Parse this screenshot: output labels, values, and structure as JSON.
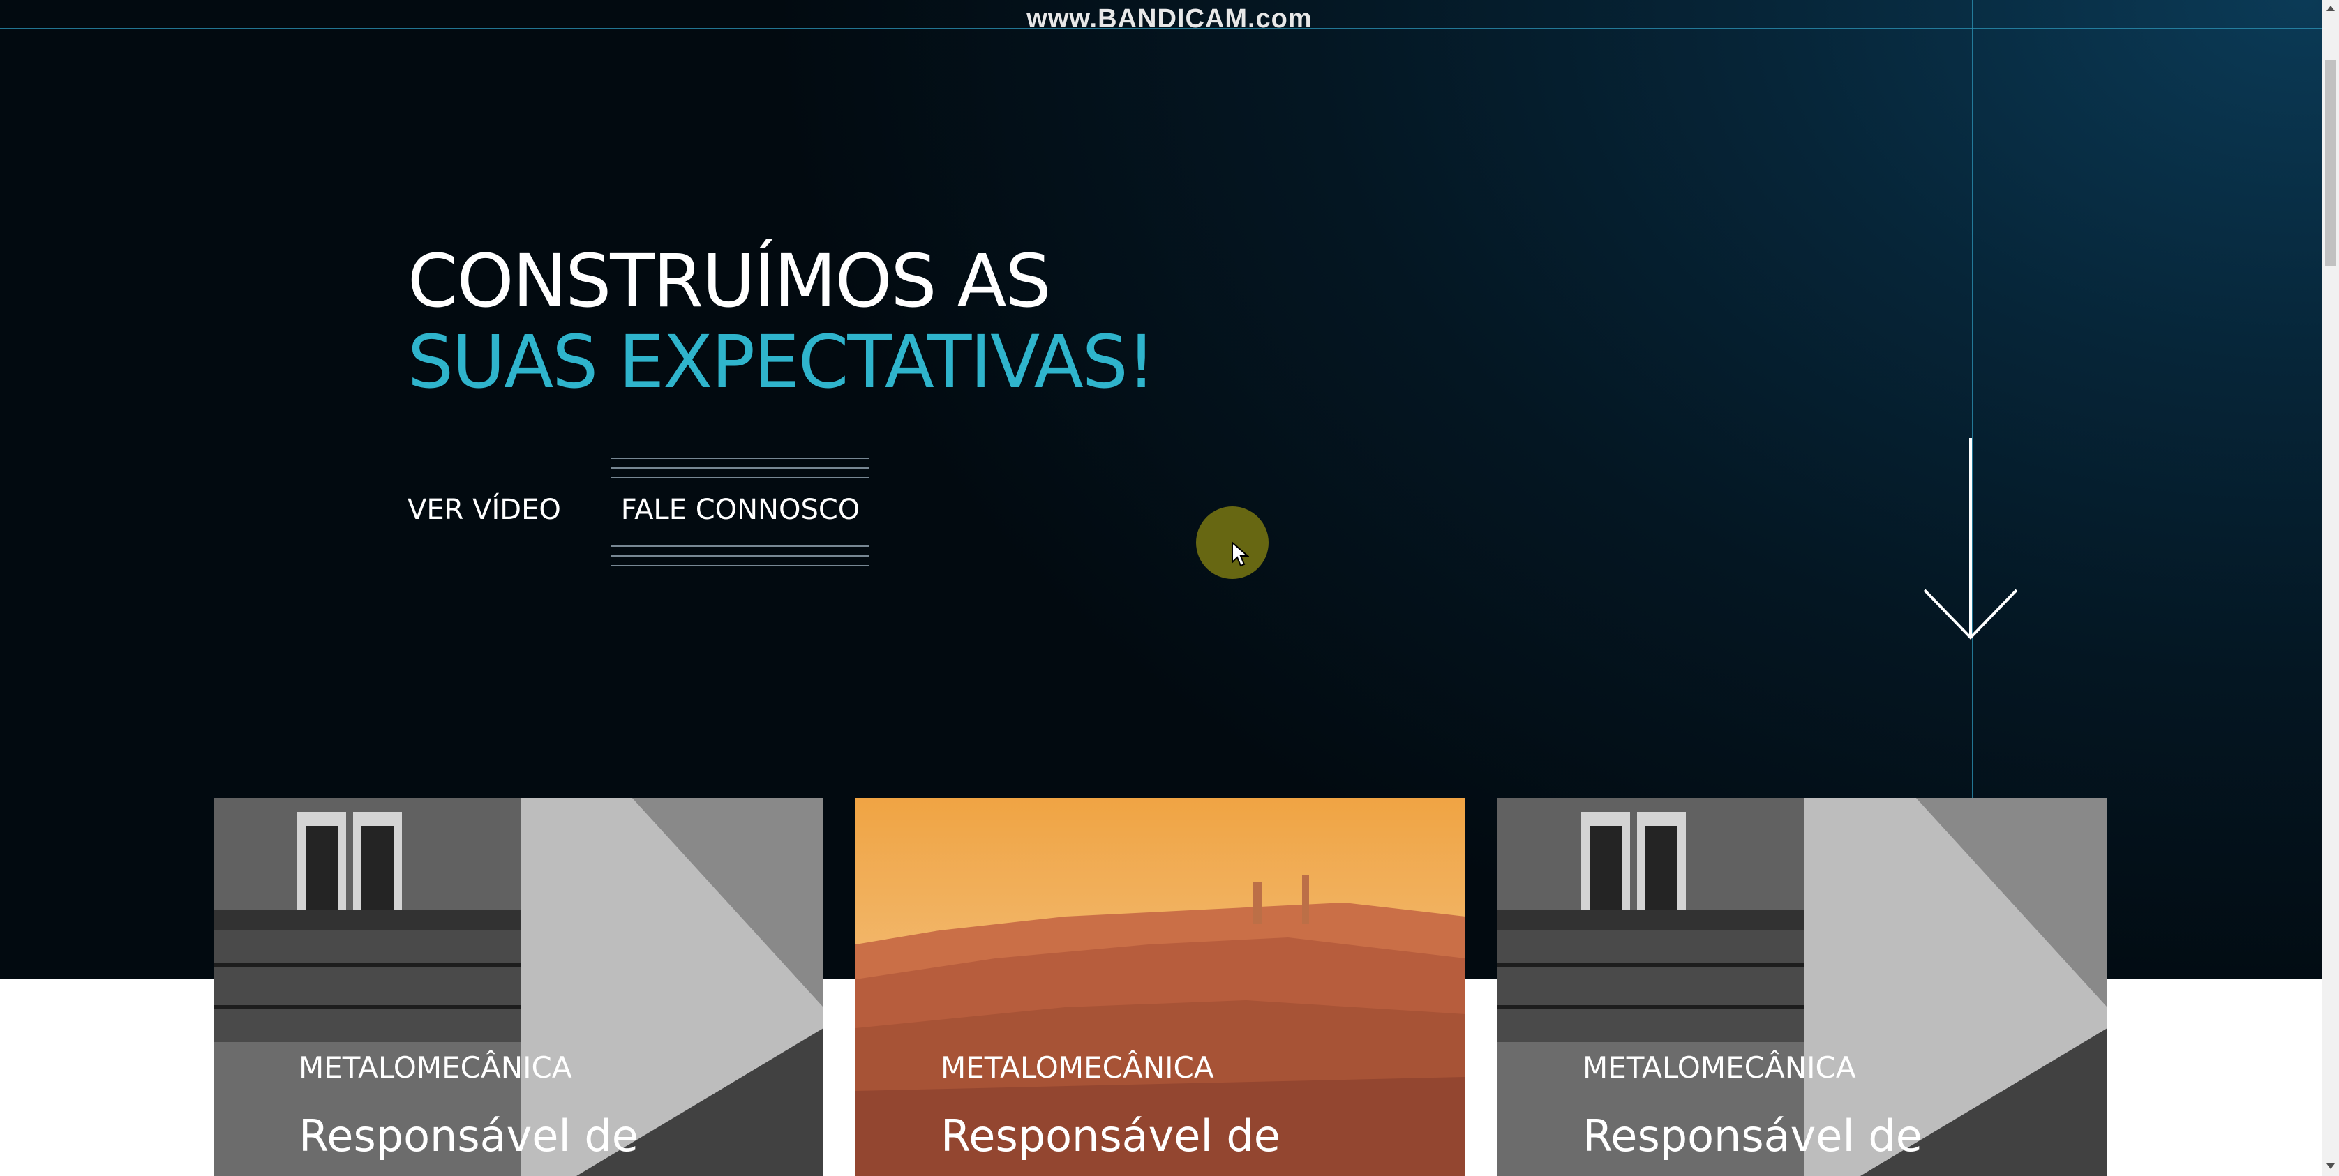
{
  "recording_watermark": "www.BANDICAM.com",
  "hero": {
    "headline_line1": "CONSTRUÍMOS AS",
    "headline_line2": "SUAS EXPECTATIVAS!",
    "buttons": {
      "video_label": "VER VÍDEO",
      "contact_label": "FALE CONNOSCO"
    },
    "scroll_down_icon": "arrow-down-icon"
  },
  "cards": [
    {
      "image": "building-balcony-bw",
      "category": "METALOMECÂNICA",
      "title": "Responsável de"
    },
    {
      "image": "city-sunset-orange",
      "category": "METALOMECÂNICA",
      "title": "Responsável de"
    },
    {
      "image": "building-balcony-bw",
      "category": "METALOMECÂNICA",
      "title": "Responsável de"
    }
  ],
  "colors": {
    "accent": "#2fb4cc",
    "hero_dark": "#041622",
    "line_accent": "#2b8fb0"
  }
}
